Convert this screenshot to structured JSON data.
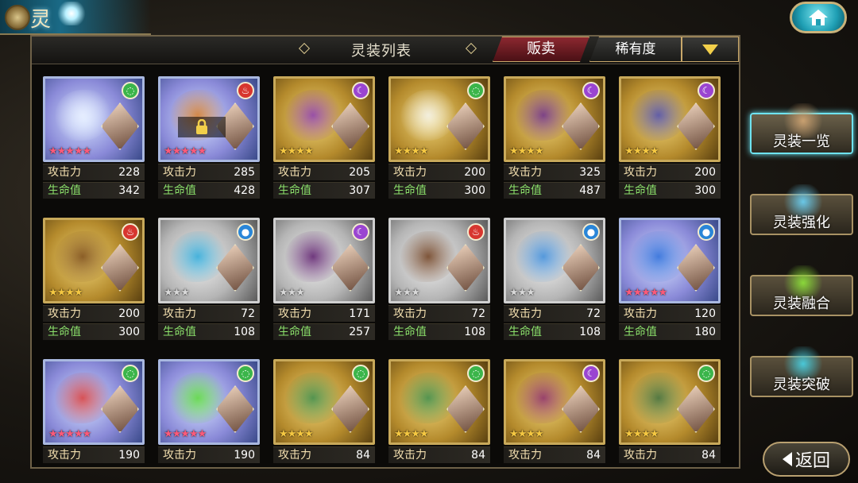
{
  "header": {
    "title_tab": "灵",
    "list_title": "灵装列表",
    "sell_label": "贩卖",
    "sort_label": "稀有度"
  },
  "stat_labels": {
    "attack": "攻击力",
    "hp": "生命值"
  },
  "cards": [
    {
      "attack": "228",
      "hp": "342",
      "element": "green",
      "frame": "blue",
      "stars": "★★★★★",
      "star_color": "pink",
      "locked": false,
      "item_color": "#e9f0ff"
    },
    {
      "attack": "285",
      "hp": "428",
      "element": "red",
      "frame": "blue",
      "stars": "★★★★★",
      "star_color": "pink",
      "locked": true,
      "item_color": "#d47a2a"
    },
    {
      "attack": "205",
      "hp": "307",
      "element": "purple",
      "frame": "gold",
      "stars": "★★★★",
      "star_color": "gold",
      "locked": false,
      "item_color": "#8a3ab0"
    },
    {
      "attack": "200",
      "hp": "300",
      "element": "green",
      "frame": "gold",
      "stars": "★★★★",
      "star_color": "gold",
      "locked": false,
      "item_color": "#f4f4f0"
    },
    {
      "attack": "325",
      "hp": "487",
      "element": "purple",
      "frame": "gold",
      "stars": "★★★★",
      "star_color": "gold",
      "locked": false,
      "item_color": "#6a2a8a"
    },
    {
      "attack": "200",
      "hp": "300",
      "element": "purple",
      "frame": "gold",
      "stars": "★★★★",
      "star_color": "gold",
      "locked": false,
      "item_color": "#4a4ab0"
    },
    {
      "attack": "200",
      "hp": "300",
      "element": "red",
      "frame": "gold",
      "stars": "★★★★",
      "star_color": "gold",
      "locked": false,
      "item_color": "#7a4a1a"
    },
    {
      "attack": "72",
      "hp": "108",
      "element": "blue",
      "frame": "silver",
      "stars": "★★★",
      "star_color": "gray",
      "locked": false,
      "item_color": "#2aa8d8"
    },
    {
      "attack": "171",
      "hp": "257",
      "element": "purple",
      "frame": "silver",
      "stars": "★★★",
      "star_color": "gray",
      "locked": false,
      "item_color": "#5a1a6a"
    },
    {
      "attack": "72",
      "hp": "108",
      "element": "red",
      "frame": "silver",
      "stars": "★★★",
      "star_color": "gray",
      "locked": false,
      "item_color": "#6a3a1a"
    },
    {
      "attack": "72",
      "hp": "108",
      "element": "blue",
      "frame": "silver",
      "stars": "★★★",
      "star_color": "gray",
      "locked": false,
      "item_color": "#3a8ad8"
    },
    {
      "attack": "120",
      "hp": "180",
      "element": "blue",
      "frame": "blue",
      "stars": "★★★★★",
      "star_color": "pink",
      "locked": false,
      "item_color": "#2a6ad8"
    },
    {
      "attack": "190",
      "hp": "",
      "element": "green",
      "frame": "blue",
      "stars": "★★★★★",
      "star_color": "pink",
      "locked": false,
      "item_color": "#d83a3a"
    },
    {
      "attack": "190",
      "hp": "",
      "element": "green",
      "frame": "blue",
      "stars": "★★★★★",
      "star_color": "pink",
      "locked": false,
      "item_color": "#5ad83a"
    },
    {
      "attack": "84",
      "hp": "",
      "element": "green",
      "frame": "gold",
      "stars": "★★★★",
      "star_color": "gold",
      "locked": false,
      "item_color": "#3a8a4a"
    },
    {
      "attack": "84",
      "hp": "",
      "element": "green",
      "frame": "gold",
      "stars": "★★★★",
      "star_color": "gold",
      "locked": false,
      "item_color": "#3a8a4a"
    },
    {
      "attack": "84",
      "hp": "",
      "element": "purple",
      "frame": "gold",
      "stars": "★★★★",
      "star_color": "gold",
      "locked": false,
      "item_color": "#8a2a6a"
    },
    {
      "attack": "84",
      "hp": "",
      "element": "green",
      "frame": "gold",
      "stars": "★★★★",
      "star_color": "gold",
      "locked": false,
      "item_color": "#3a6a3a"
    }
  ],
  "side_menu": [
    {
      "label": "灵装一览",
      "icon": "book-icon",
      "active": true,
      "icon_color": "#c9a070"
    },
    {
      "label": "灵装强化",
      "icon": "crystal-icon",
      "active": false,
      "icon_color": "#6ac8e8"
    },
    {
      "label": "灵装融合",
      "icon": "potion-icon",
      "active": false,
      "icon_color": "#8ad83a"
    },
    {
      "label": "灵装突破",
      "icon": "gem-icon",
      "active": false,
      "icon_color": "#4ac8d8"
    }
  ],
  "back_label": "返回"
}
